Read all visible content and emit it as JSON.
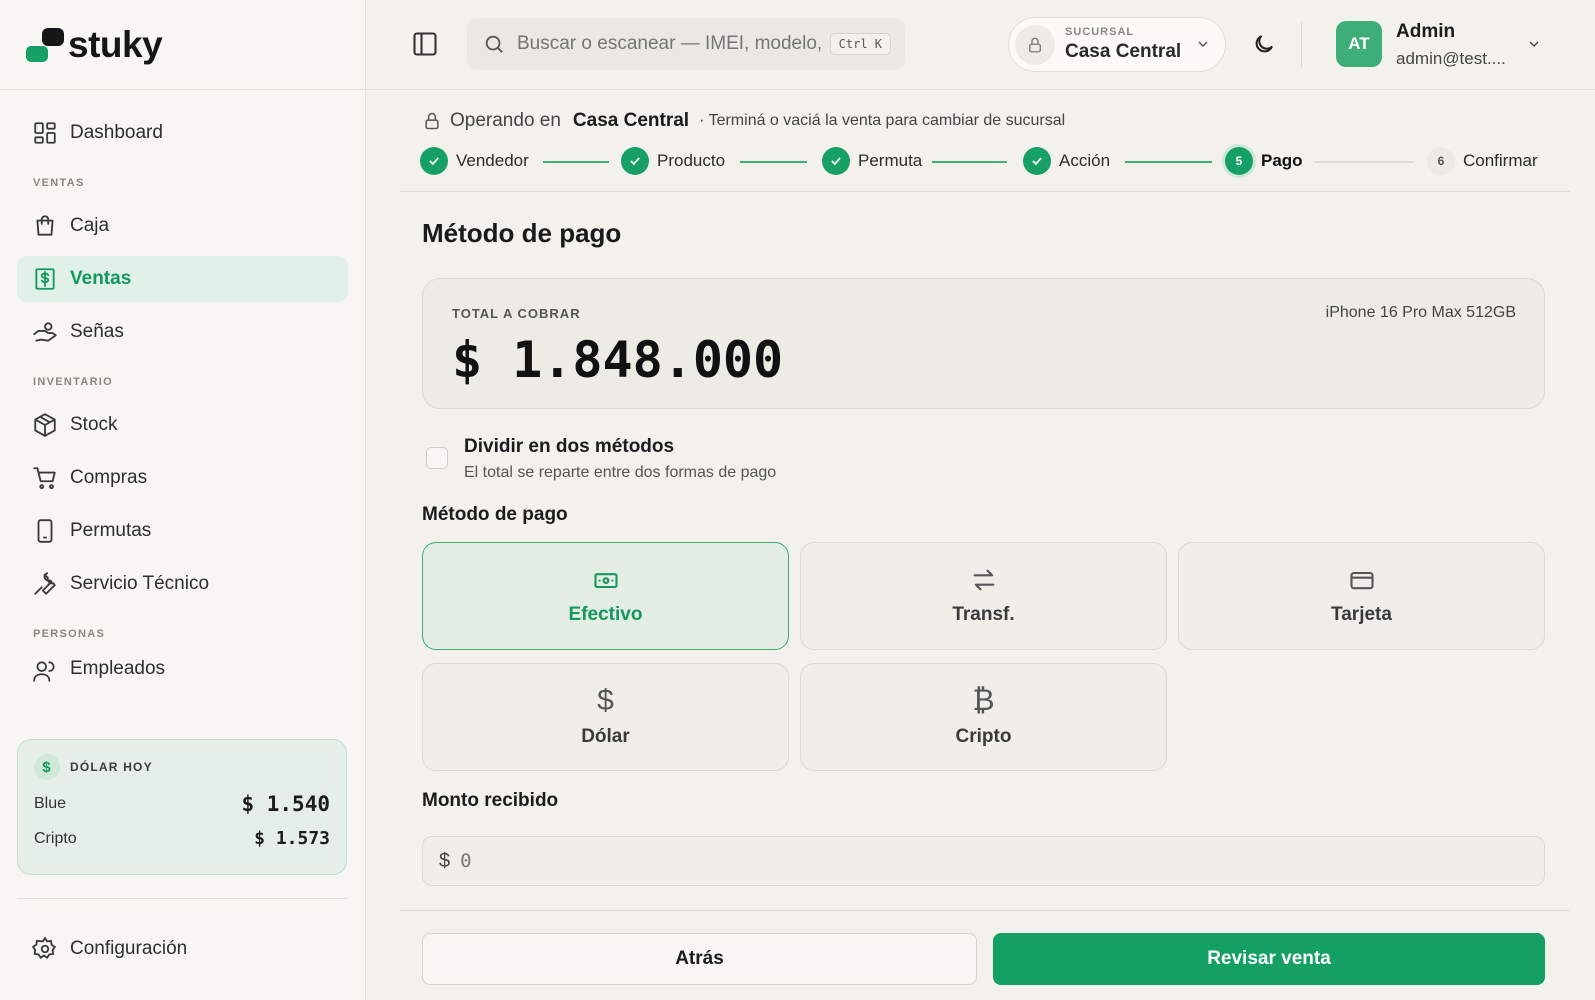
{
  "brand": {
    "name": "stuky"
  },
  "sidebar": {
    "dashboard": "Dashboard",
    "sections": [
      "VENTAS",
      "INVENTARIO",
      "PERSONAS"
    ],
    "ventas_items": [
      {
        "label": "Caja",
        "icon": "bag-icon"
      },
      {
        "label": "Ventas",
        "icon": "dollar-receipt-icon",
        "active": true
      },
      {
        "label": "Señas",
        "icon": "hand-coin-icon"
      }
    ],
    "inventario_items": [
      {
        "label": "Stock",
        "icon": "box-icon"
      },
      {
        "label": "Compras",
        "icon": "cart-icon"
      },
      {
        "label": "Permutas",
        "icon": "phone-icon"
      },
      {
        "label": "Servicio Técnico",
        "icon": "wrench-icon"
      }
    ],
    "personas_items": [
      {
        "label": "Empleados",
        "icon": "users-icon"
      }
    ],
    "dolar": {
      "title": "DÓLAR HOY",
      "rows": [
        {
          "label": "Blue",
          "value": "$ 1.540"
        },
        {
          "label": "Cripto",
          "value": "$ 1.573"
        }
      ]
    },
    "config": "Configuración"
  },
  "topbar": {
    "search_placeholder": "Buscar o escanear — IMEI, modelo, c",
    "shortcut": "Ctrl K",
    "branch_label": "SUCURSAL",
    "branch_value": "Casa Central",
    "user_initials": "AT",
    "user_name": "Admin",
    "user_email": "admin@test...."
  },
  "operating": {
    "prefix": "Operando en",
    "branch": "Casa Central",
    "hint": "· Terminá o vaciá la venta para cambiar de sucursal"
  },
  "steps": [
    {
      "label": "Vendedor",
      "state": "done"
    },
    {
      "label": "Producto",
      "state": "done"
    },
    {
      "label": "Permuta",
      "state": "done"
    },
    {
      "label": "Acción",
      "state": "done"
    },
    {
      "label": "Pago",
      "num": "5",
      "state": "current"
    },
    {
      "label": "Confirmar",
      "num": "6",
      "state": "pending"
    }
  ],
  "payment": {
    "title": "Método de pago",
    "total_label": "TOTAL A COBRAR",
    "total_value": "$ 1.848.000",
    "product": "iPhone 16 Pro Max 512GB",
    "split_title": "Dividir en dos métodos",
    "split_sub": "El total se reparte entre dos formas de pago",
    "methods_label": "Método de pago",
    "methods": [
      {
        "label": "Efectivo",
        "icon": "cash-icon",
        "selected": true
      },
      {
        "label": "Transf.",
        "icon": "transfer-icon"
      },
      {
        "label": "Tarjeta",
        "icon": "card-icon"
      },
      {
        "label": "Dólar",
        "icon": "dollar-icon",
        "glyph": "$"
      },
      {
        "label": "Cripto",
        "icon": "bitcoin-icon",
        "glyph": "₿"
      }
    ],
    "amount_label": "Monto recibido",
    "amount_currency": "$",
    "amount_placeholder": "0"
  },
  "actions": {
    "back": "Atrás",
    "next": "Revisar venta"
  },
  "colors": {
    "accent": "#13a062",
    "accent_soft": "#e2f1e8",
    "background": "#f3f1ec"
  }
}
